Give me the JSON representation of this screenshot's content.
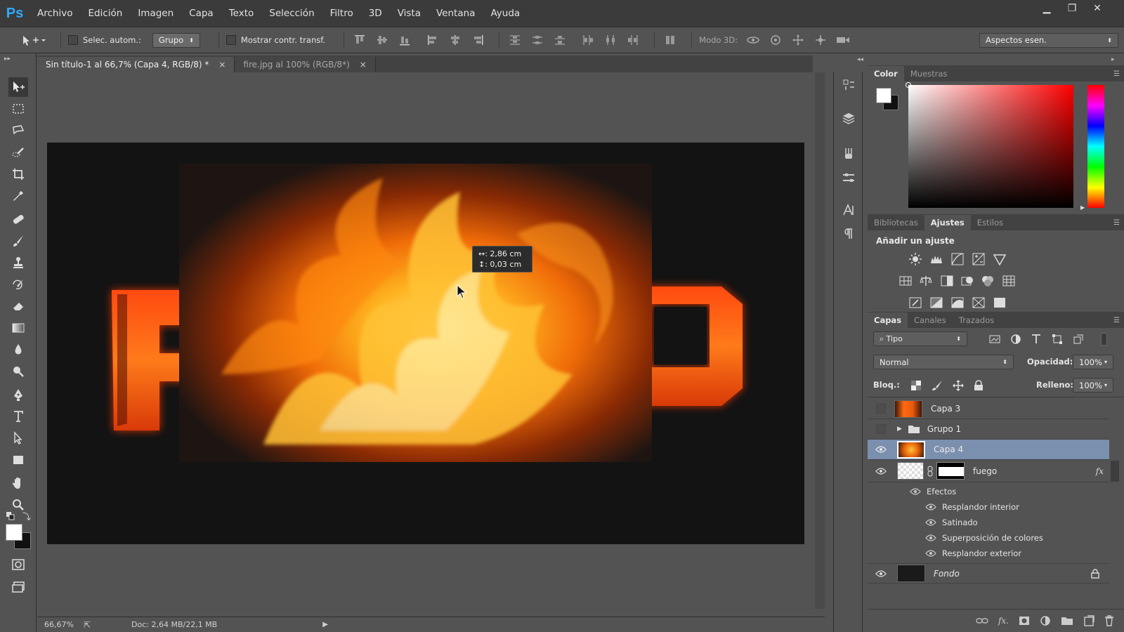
{
  "app": {
    "logo": "Ps",
    "accent": "#31a8ff"
  },
  "menu": [
    "Archivo",
    "Edición",
    "Imagen",
    "Capa",
    "Texto",
    "Selección",
    "Filtro",
    "3D",
    "Vista",
    "Ventana",
    "Ayuda"
  ],
  "window_controls": {
    "minimize": "▁",
    "maximize": "❐",
    "close": "✕"
  },
  "options": {
    "auto_select_label": "Selec. autom.:",
    "auto_select_value": "Grupo",
    "show_transform_label": "Mostrar contr. transf.",
    "mode3d_label": "Modo 3D:",
    "workspace_value": "Aspectos esen."
  },
  "tabs": [
    {
      "label": "Sin título-1 al 66,7% (Capa 4, RGB/8) *",
      "close": "×"
    },
    {
      "label": "fire.jpg al 100% (RGB/8*)",
      "close": "×"
    }
  ],
  "tooltip": {
    "line1": "↔: 2,86 cm",
    "line2": "↕: 0,03 cm"
  },
  "status": {
    "zoom": "66,67%",
    "doc": "Doc: 2,64 MB/22,1 MB"
  },
  "color_panel": {
    "tabs": [
      "Color",
      "Muestras"
    ],
    "hue": "#ff0000"
  },
  "adjust_panel": {
    "tabs": [
      "Bibliotecas",
      "Ajustes",
      "Estilos"
    ],
    "heading": "Añadir un ajuste"
  },
  "layers_panel": {
    "tabs": [
      "Capas",
      "Canales",
      "Trazados"
    ],
    "filter_value": "Tipo",
    "blend_mode": "Normal",
    "opacity_label": "Opacidad:",
    "opacity_value": "100%",
    "lock_label": "Bloq.:",
    "fill_label": "Relleno:",
    "fill_value": "100%",
    "layers": [
      {
        "name": "Capa 3"
      },
      {
        "name": "Grupo 1"
      },
      {
        "name": "Capa 4"
      },
      {
        "name": "fuego",
        "fx": "fx"
      },
      {
        "name": "Fondo"
      }
    ],
    "effects_label": "Efectos",
    "effects": [
      "Resplandor interior",
      "Satinado",
      "Superposición de colores",
      "Resplandor exterior"
    ]
  }
}
